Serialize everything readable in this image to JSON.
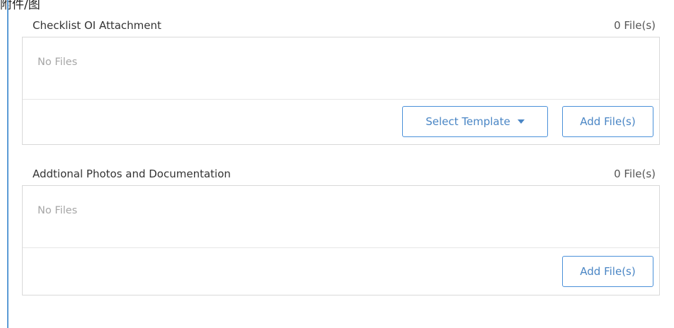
{
  "page": {
    "top_label": "附件/图"
  },
  "sections": [
    {
      "title": "Checklist OI Attachment",
      "file_count": "0 File(s)",
      "empty_text": "No Files",
      "select_template_label": "Select Template",
      "add_files_label": "Add File(s)"
    },
    {
      "title": "Addtional Photos and Documentation",
      "file_count": "0 File(s)",
      "empty_text": "No Files",
      "add_files_label": "Add File(s)"
    }
  ],
  "colors": {
    "accent": "#4a90d9",
    "left_rule": "#5b9bd5",
    "border": "#d9d9d9",
    "muted_text": "#a6a6a6"
  },
  "icons": {
    "dropdown": "caret-down-icon"
  }
}
